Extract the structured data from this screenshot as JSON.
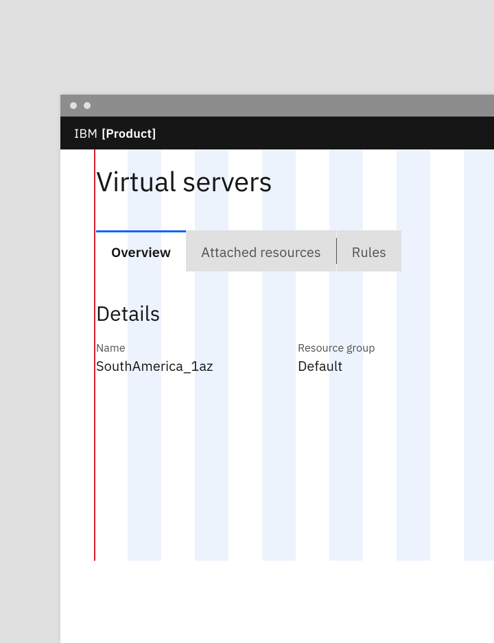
{
  "brand": {
    "prefix": "IBM",
    "product": "[Product]"
  },
  "page": {
    "title": "Virtual servers"
  },
  "tabs": [
    {
      "label": "Overview",
      "active": true
    },
    {
      "label": "Attached resources",
      "active": false
    },
    {
      "label": "Rules",
      "active": false
    }
  ],
  "details": {
    "section_title": "Details",
    "name_label": "Name",
    "name_value": "SouthAmerica_1az",
    "rg_label": "Resource group",
    "rg_value": "Default"
  }
}
